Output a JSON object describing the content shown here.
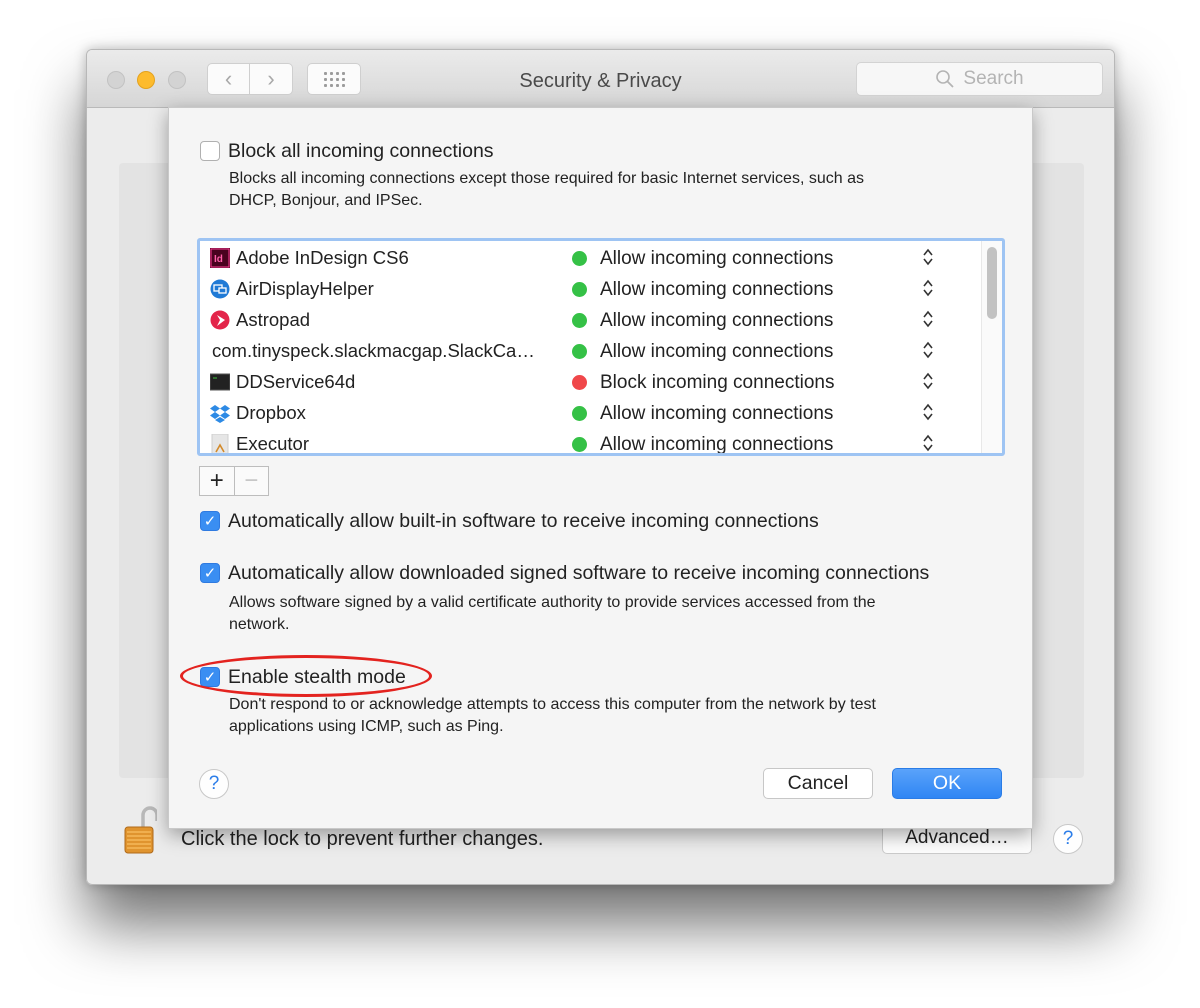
{
  "window": {
    "title": "Security & Privacy",
    "search_placeholder": "Search",
    "nav_back_glyph": "‹",
    "nav_forward_glyph": "›"
  },
  "main_pane": {
    "lock_text": "Click the lock to prevent further changes.",
    "advanced_label": "Advanced…",
    "help_label": "?"
  },
  "sheet": {
    "block_all": {
      "label": "Block all incoming connections",
      "checked": false,
      "description_line1": "Blocks all incoming connections except those required for basic Internet services,  such as",
      "description_line2": "DHCP, Bonjour, and IPSec."
    },
    "apps": [
      {
        "name": "Adobe InDesign CS6",
        "icon": "indesign-icon",
        "status": "Allow incoming connections",
        "allowed": true
      },
      {
        "name": "AirDisplayHelper",
        "icon": "airdisplay-icon",
        "status": "Allow incoming connections",
        "allowed": true
      },
      {
        "name": "Astropad",
        "icon": "astropad-icon",
        "status": "Allow incoming connections",
        "allowed": true
      },
      {
        "name": "com.tinyspeck.slackmacgap.SlackCa…",
        "icon": "",
        "status": "Allow incoming connections",
        "allowed": true
      },
      {
        "name": "DDService64d",
        "icon": "terminal-icon",
        "status": "Block incoming connections",
        "allowed": false
      },
      {
        "name": "Dropbox",
        "icon": "dropbox-icon",
        "status": "Allow incoming connections",
        "allowed": true
      },
      {
        "name": "Executor",
        "icon": "executor-icon",
        "status": "Allow incoming connections",
        "allowed": true
      }
    ],
    "add_label": "+",
    "remove_label": "−",
    "auto_builtin": {
      "label": "Automatically allow built-in software to receive incoming connections",
      "checked": true
    },
    "auto_signed": {
      "label": "Automatically allow downloaded signed software to receive incoming connections",
      "checked": true,
      "description_line1": "Allows software signed by a valid certificate authority to provide services accessed from the",
      "description_line2": "network."
    },
    "stealth": {
      "label": "Enable stealth mode",
      "checked": true,
      "description_line1": "Don't respond to or acknowledge attempts to access this computer from the network by test",
      "description_line2": "applications using ICMP, such as Ping."
    },
    "help_label": "?",
    "cancel_label": "Cancel",
    "ok_label": "OK",
    "check_glyph": "✓"
  },
  "colors": {
    "allow": "#35c146",
    "block": "#f0474a",
    "accent": "#3a8ef2",
    "highlight": "#e3231f"
  }
}
